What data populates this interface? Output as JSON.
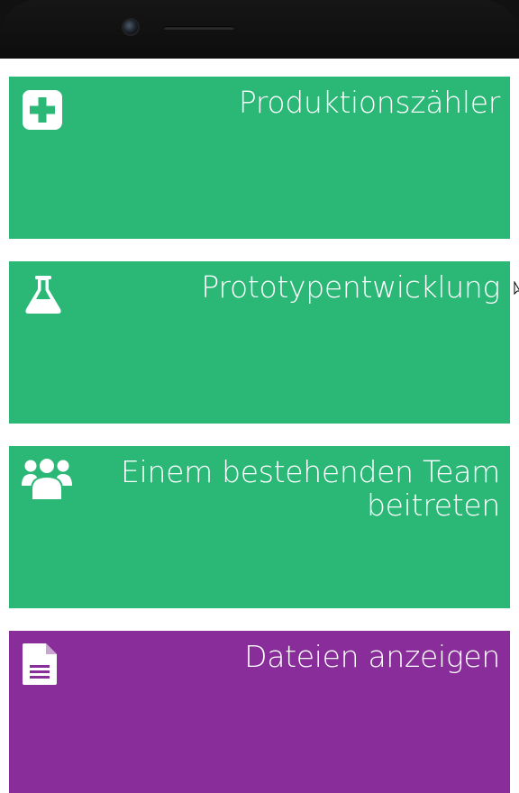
{
  "device": {
    "has_camera": true,
    "has_speaker": true
  },
  "menu": {
    "items": [
      {
        "label": "Produktionszähler",
        "icon": "plus-square-icon",
        "color": "#2bb877"
      },
      {
        "label": "Prototypentwicklung",
        "icon": "flask-icon",
        "color": "#2bb877"
      },
      {
        "label": "Einem bestehenden Team beitreten",
        "icon": "users-icon",
        "color": "#2bb877"
      },
      {
        "label": "Dateien anzeigen",
        "icon": "document-icon",
        "color": "#882d9a"
      }
    ]
  },
  "colors": {
    "accent_green": "#2bb877",
    "accent_purple": "#882d9a",
    "bezel": "#111111"
  }
}
